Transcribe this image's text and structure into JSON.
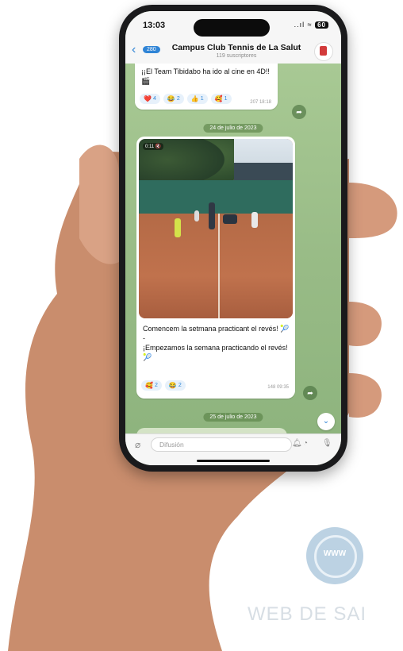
{
  "status": {
    "time": "13:03",
    "signal_label": "..ıl",
    "wifi_label": "≈",
    "battery": "60"
  },
  "header": {
    "back_count": "280",
    "title": "Campus Club Tennis de La Salut",
    "subtitle": "119 suscriptores"
  },
  "messages": [
    {
      "text": "¡¡El Team Tibidabo ha ido al cine en 4D!! 🎬",
      "reactions": [
        {
          "emoji": "❤️",
          "count": "4"
        },
        {
          "emoji": "😂",
          "count": "2"
        },
        {
          "emoji": "👍",
          "count": "1"
        },
        {
          "emoji": "🥰",
          "count": "1"
        }
      ],
      "views": "207 18:18"
    },
    {
      "video_duration": "0:11 🔇",
      "text_ca": "Comencem la setmana practicant el revés! 🎾",
      "separator": "-",
      "text_es": "¡Empezamos la semana practicando el revés! 🎾",
      "reactions": [
        {
          "emoji": "🥰",
          "count": "2"
        },
        {
          "emoji": "😂",
          "count": "2"
        }
      ],
      "views": "148 09:35"
    }
  ],
  "dates": {
    "first": "24 de julio de 2023",
    "second": "25 de julio de 2023"
  },
  "input": {
    "placeholder": "Difusión",
    "value": ""
  },
  "watermark": {
    "text": "WEB DE SAI",
    "globe_label": "WWW"
  }
}
